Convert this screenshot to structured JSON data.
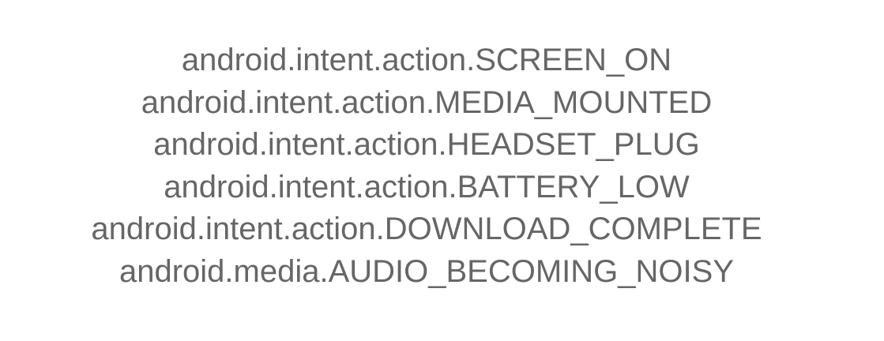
{
  "intents": [
    "android.intent.action.SCREEN_ON",
    "android.intent.action.MEDIA_MOUNTED",
    "android.intent.action.HEADSET_PLUG",
    "android.intent.action.BATTERY_LOW",
    "android.intent.action.DOWNLOAD_COMPLETE",
    "android.media.AUDIO_BECOMING_NOISY"
  ],
  "colors": {
    "background": "#ffffff",
    "text": "#666666"
  }
}
